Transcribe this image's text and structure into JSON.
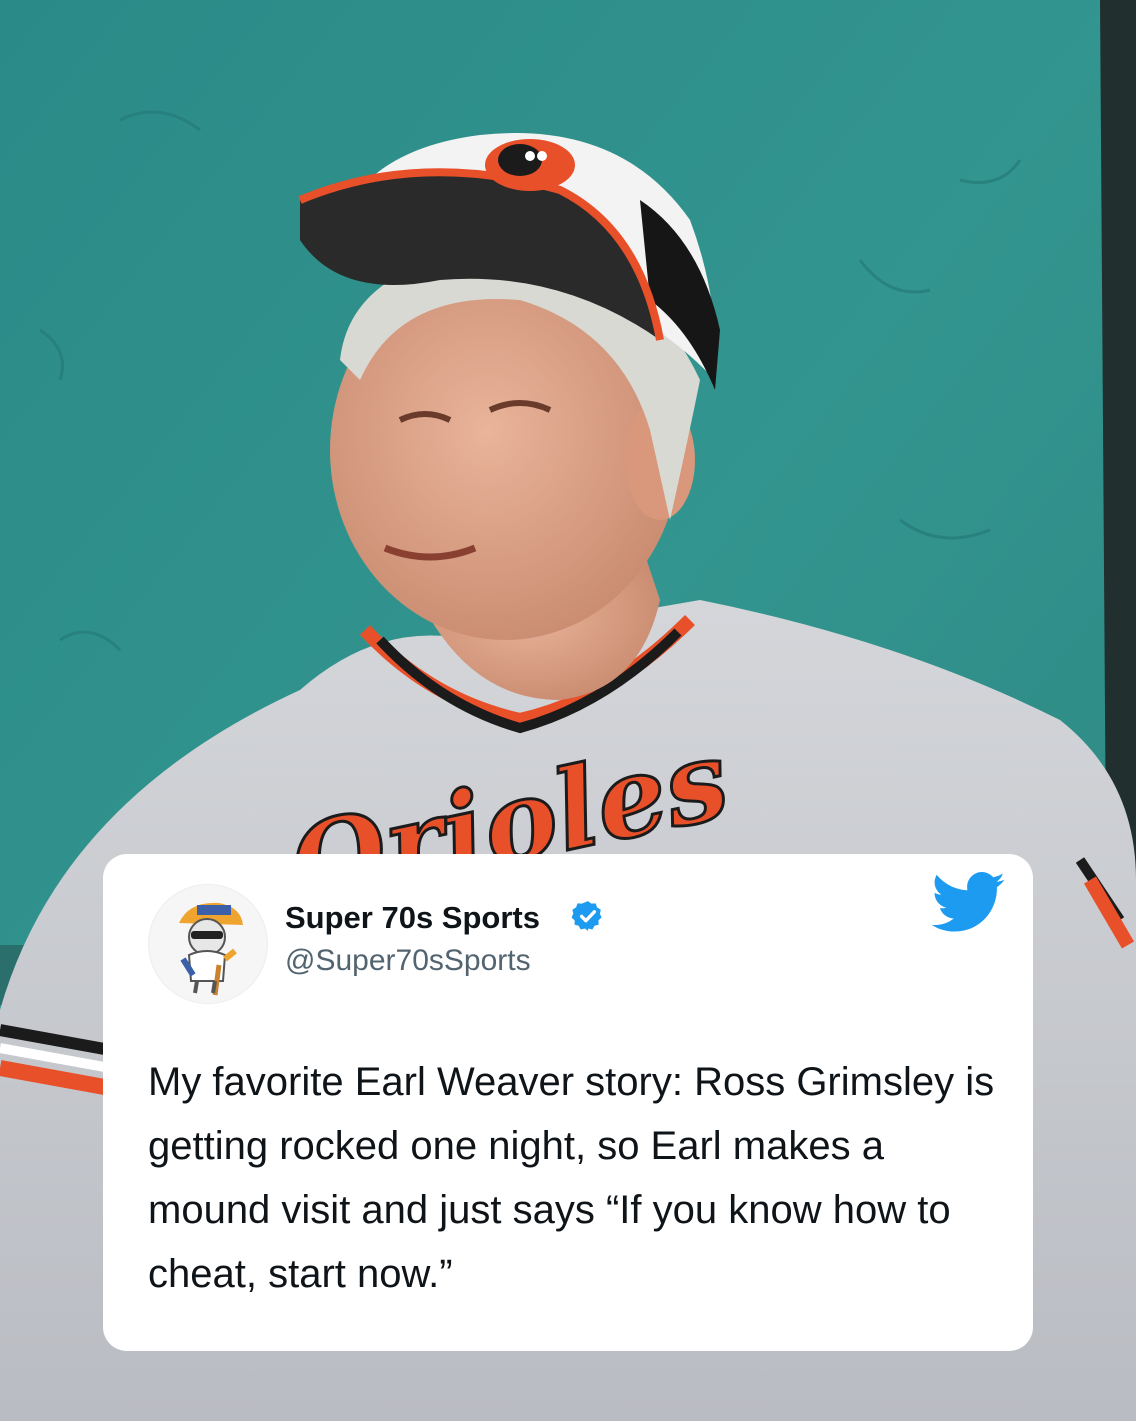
{
  "tweet": {
    "display_name": "Super 70s Sports",
    "handle": "@Super70sSports",
    "text": "My favorite Earl Weaver story: Ross Grimsley is getting rocked one night, so Earl makes a mound visit and just says “If you know how to cheat, start now.”"
  },
  "icons": {
    "verified": "verified-badge-icon",
    "brand": "twitter-bird-icon"
  },
  "photo": {
    "jersey_lettering": "Orioles"
  },
  "colors": {
    "background_wall": "#2f8f8c",
    "card": "#ffffff",
    "text_primary": "#0f1419",
    "text_secondary": "#536471",
    "twitter_blue": "#1d9bf0",
    "orioles_orange": "#e8502a"
  }
}
